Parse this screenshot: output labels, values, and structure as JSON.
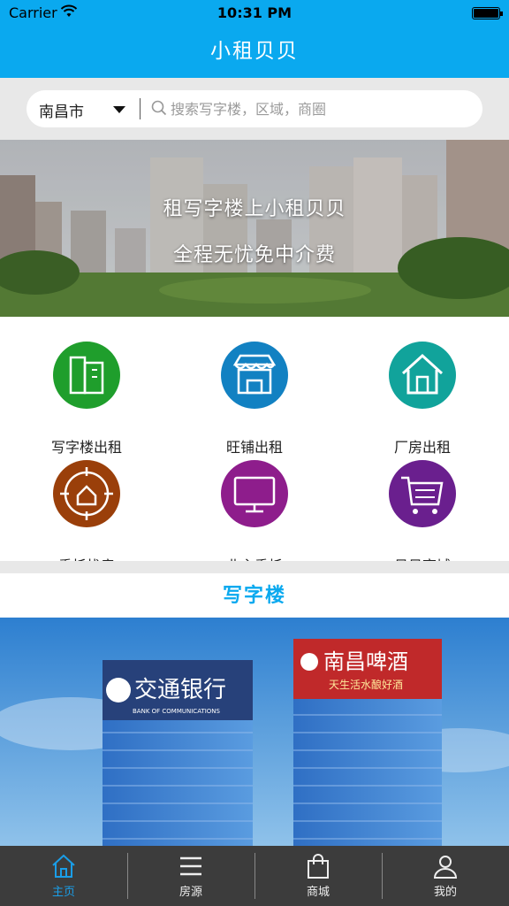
{
  "status_bar": {
    "carrier": "Carrier",
    "time": "10:31 PM"
  },
  "nav": {
    "title": "小租贝贝"
  },
  "search": {
    "city": "南昌市",
    "placeholder": "搜索写字楼，区域，商圈"
  },
  "banner": {
    "line1": "租写字楼上小租贝贝",
    "line2": "全程无忧免中介费"
  },
  "categories": [
    {
      "label": "写字楼出租",
      "icon": "office-building-icon",
      "color": "#1f9e2c"
    },
    {
      "label": "旺铺出租",
      "icon": "shop-icon",
      "color": "#1281c2"
    },
    {
      "label": "厂房出租",
      "icon": "factory-house-icon",
      "color": "#11a39b"
    },
    {
      "label": "委托找房",
      "icon": "house-target-icon",
      "color": "#9a3f0a"
    },
    {
      "label": "业主委托",
      "icon": "monitor-icon",
      "color": "#8e1d8c"
    },
    {
      "label": "贝贝商城",
      "icon": "shopping-cart-icon",
      "color": "#6a1f8e"
    }
  ],
  "section": {
    "title": "写字楼"
  },
  "office_photo": {
    "left_sign": "交通银行",
    "left_sign_en": "BANK OF COMMUNICATIONS",
    "right_sign": "南昌啤酒",
    "right_sign_sub": "天生活水酿好酒"
  },
  "tabs": [
    {
      "label": "主页",
      "icon": "home-icon",
      "active": true
    },
    {
      "label": "房源",
      "icon": "list-icon",
      "active": false
    },
    {
      "label": "商城",
      "icon": "shopping-bag-icon",
      "active": false
    },
    {
      "label": "我的",
      "icon": "user-icon",
      "active": false
    }
  ],
  "colors": {
    "accent": "#0aa9ef",
    "tab_active": "#1a9ee8",
    "tabbar_bg": "#3c3c3c"
  }
}
